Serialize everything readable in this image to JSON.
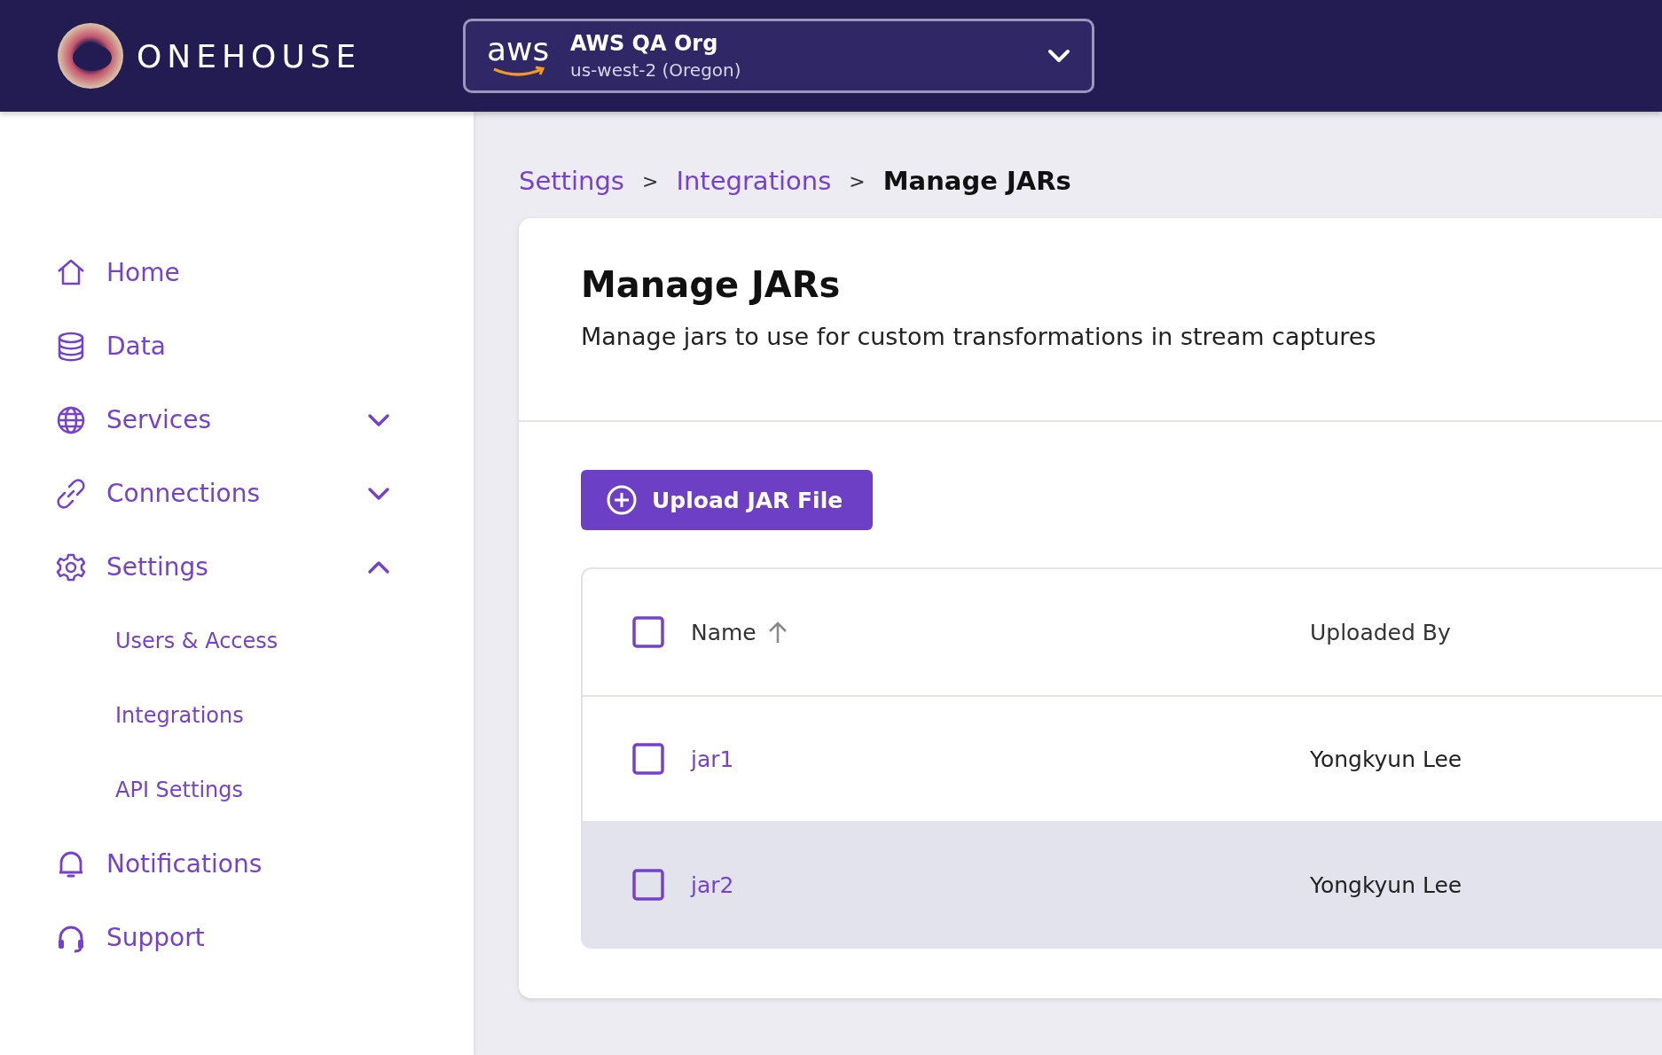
{
  "header": {
    "brand": "ONEHOUSE",
    "org_selector": {
      "logo_text": "aws",
      "name": "AWS QA Org",
      "region": "us-west-2 (Oregon)"
    }
  },
  "sidebar": {
    "items": [
      {
        "label": "Home"
      },
      {
        "label": "Data"
      },
      {
        "label": "Services",
        "expanded": false
      },
      {
        "label": "Connections",
        "expanded": false
      },
      {
        "label": "Settings",
        "expanded": true,
        "children": [
          {
            "label": "Users & Access"
          },
          {
            "label": "Integrations"
          },
          {
            "label": "API Settings"
          }
        ]
      },
      {
        "label": "Notifications"
      },
      {
        "label": "Support"
      }
    ]
  },
  "breadcrumb": [
    {
      "kind": "link",
      "text": "Settings"
    },
    {
      "kind": "separator",
      "text": ">"
    },
    {
      "kind": "link",
      "text": "Integrations"
    },
    {
      "kind": "separator",
      "text": ">"
    },
    {
      "kind": "current",
      "text": "Manage JARs"
    }
  ],
  "page": {
    "title": "Manage JARs",
    "subtitle": "Manage jars to use for custom transformations in stream captures",
    "upload_button": "Upload JAR File"
  },
  "table": {
    "select_all_checked": false,
    "columns": [
      {
        "label": "Name",
        "sorted_ascending": true
      },
      {
        "label": "Uploaded By",
        "sorted_ascending": false
      }
    ],
    "rows": [
      {
        "name": "jar1",
        "uploaded_by": "Yongkyun Lee",
        "checked": false,
        "hovered": false
      },
      {
        "name": "jar2",
        "uploaded_by": "Yongkyun Lee",
        "checked": false,
        "hovered": true
      }
    ]
  }
}
